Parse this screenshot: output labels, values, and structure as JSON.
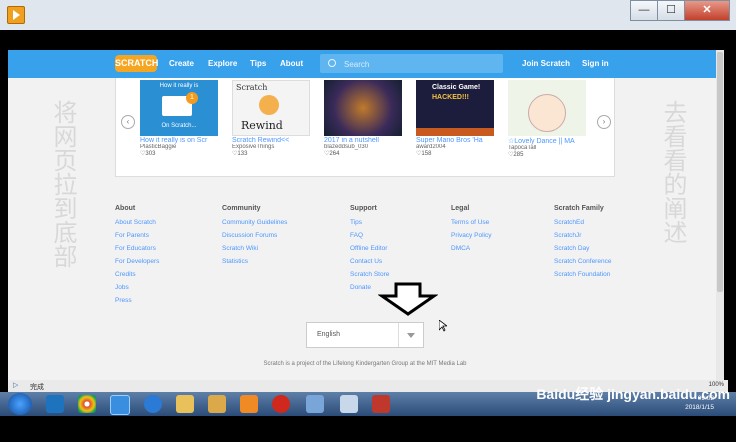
{
  "window": {
    "buttons": [
      "—",
      "☐",
      "✕"
    ]
  },
  "nav": {
    "logo": "SCRATCH",
    "links": [
      "Create",
      "Explore",
      "Tips",
      "About"
    ],
    "search_placeholder": "Search",
    "join": "Join Scratch",
    "signin": "Sign in"
  },
  "cards": [
    {
      "title": "How it really is on Scr",
      "author": "PlasticBaggie",
      "loves": "303",
      "thumb_text": "How it really is",
      "thumb_sub": "On Scratch..."
    },
    {
      "title": "Scratch Rewind<<",
      "author": "ExposiveThings",
      "loves": "133",
      "thumb_text": "Scratch",
      "thumb_sub": "Rewind"
    },
    {
      "title": "2017 in a nutshell",
      "author": "blazeddsub_030",
      "loves": "264",
      "thumb_text": "",
      "thumb_sub": ""
    },
    {
      "title": "Super Mario Bros 'Ha",
      "author": "award2004",
      "loves": "158",
      "thumb_text": "Classic Game!",
      "thumb_sub": "HACKED!!!"
    },
    {
      "title": "☆Lovely Dance || MA",
      "author": "TapocaTall",
      "loves": "285",
      "thumb_text": "",
      "thumb_sub": ""
    }
  ],
  "footer": {
    "columns": [
      {
        "title": "About",
        "links": [
          "About Scratch",
          "For Parents",
          "For Educators",
          "For Developers",
          "Credits",
          "Jobs",
          "Press"
        ]
      },
      {
        "title": "Community",
        "links": [
          "Community Guidelines",
          "Discussion Forums",
          "Scratch Wiki",
          "Statistics"
        ]
      },
      {
        "title": "Support",
        "links": [
          "Tips",
          "FAQ",
          "Offline Editor",
          "Contact Us",
          "Scratch Store",
          "Donate"
        ]
      },
      {
        "title": "Legal",
        "links": [
          "Terms of Use",
          "Privacy Policy",
          "DMCA"
        ]
      },
      {
        "title": "Scratch Family",
        "links": [
          "ScratchEd",
          "ScratchJr",
          "Scratch Day",
          "Scratch Conference",
          "Scratch Foundation"
        ]
      }
    ],
    "language": "English",
    "lifelong": "Scratch is a project of the Lifelong Kindergarten Group at the MIT Media Lab"
  },
  "overlay": {
    "left_text": "将网页拉到底部",
    "right_text": "去看看的阐述"
  },
  "status": {
    "text": "完成",
    "zoom": "100%"
  },
  "taskbar": {
    "time": "09:02",
    "date": "2018/1/15"
  },
  "watermark": "Baidu经验 jingyan.baidu.com"
}
